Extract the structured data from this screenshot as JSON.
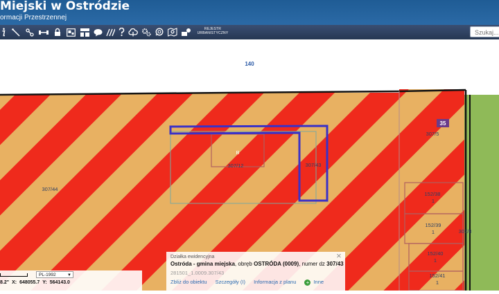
{
  "header": {
    "title": "Miejski w Ostródzie",
    "subtitle": "ormacji Przestrzennej"
  },
  "toolbar": {
    "icons": [
      "info-icon",
      "measure-line-icon",
      "link-icon",
      "width-icon",
      "lock-icon",
      "window-icon",
      "layout-icon",
      "speech-icon",
      "hatch-icon",
      "help-icon",
      "cloud-icon",
      "gears-icon",
      "zoom-icon",
      "search-map-icon",
      "layers-icon"
    ],
    "rejestr_line1": "REJESTR",
    "rejestr_line2": "URBANISTYCZNY"
  },
  "search": {
    "placeholder": "Szukaj..."
  },
  "map": {
    "colors": {
      "stripe_orange": "#e8b162",
      "stripe_red": "#ef2a1c",
      "green": "#8fba58",
      "highlight": "#3a31c7",
      "badge": "#6b3b8a"
    },
    "labels": {
      "top_number": "140",
      "parcel_307_44": "307/44",
      "parcel_307_12": "307/12",
      "parcel_307_12_sub": "B",
      "parcel_307_43": "307/43",
      "parcel_307_5": "307/5",
      "badge": "35",
      "parcel_152_38": "152/38",
      "parcel_152_38_sub": "1",
      "parcel_152_39": "152/39",
      "parcel_152_39_sub": "1",
      "parcel_152_40": "152/40",
      "parcel_152_40_sub": "1",
      "parcel_152_41": "152/41",
      "parcel_152_41_sub": "1",
      "parcel_307_right": "307/8"
    }
  },
  "popup": {
    "title": "Działka ewidencyjna",
    "location_name": "Ostróda - gmina miejska",
    "obreb_label": ", obręb ",
    "obreb_value": "OSTRÓDA (0009)",
    "numer_label": ", numer dz ",
    "numer_value": "307/43",
    "identifier": "281501_1.0009.307/43",
    "links": {
      "zoom": "Zbliż do obiektu",
      "details": "Szczegóły (I)",
      "plan_info": "Informacja z planu",
      "other": "Inne"
    }
  },
  "statusbar": {
    "scale_fragment": "8.2\"",
    "crs": "PL-1992",
    "x_label": "X:",
    "x_value": "648055.7",
    "y_label": "Y:",
    "y_value": "564143.0"
  }
}
